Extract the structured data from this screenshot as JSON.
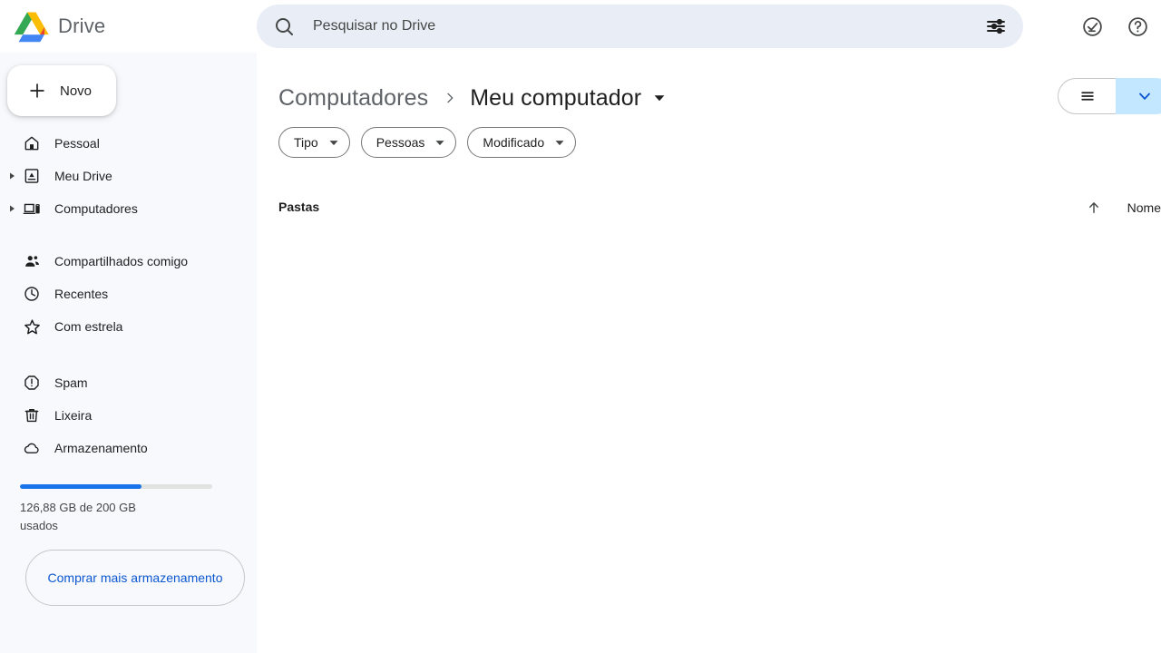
{
  "app": {
    "brand_name": "Drive",
    "logo_icon": "google-drive-logo"
  },
  "search": {
    "placeholder": "Pesquisar no Drive",
    "value": "",
    "search_icon": "search-icon",
    "tune_icon": "tune-filter-icon"
  },
  "topbar_actions": [
    {
      "name": "activity-status",
      "icon": "check-circle-icon"
    },
    {
      "name": "help",
      "icon": "help-circle-icon"
    }
  ],
  "sidebar": {
    "new_button": {
      "label": "Novo",
      "icon": "plus-icon"
    },
    "groups": [
      {
        "items": [
          {
            "label": "Pessoal",
            "icon": "home-icon",
            "expandable": false
          },
          {
            "label": "Meu Drive",
            "icon": "my-drive-icon",
            "expandable": true
          },
          {
            "label": "Computadores",
            "icon": "computer-icon",
            "expandable": true
          }
        ]
      },
      {
        "items": [
          {
            "label": "Compartilhados comigo",
            "icon": "people-icon",
            "expandable": false
          },
          {
            "label": "Recentes",
            "icon": "clock-icon",
            "expandable": false
          },
          {
            "label": "Com estrela",
            "icon": "star-icon",
            "expandable": false
          }
        ]
      },
      {
        "items": [
          {
            "label": "Spam",
            "icon": "report-icon",
            "expandable": false
          },
          {
            "label": "Lixeira",
            "icon": "trash-icon",
            "expandable": false
          },
          {
            "label": "Armazenamento",
            "icon": "cloud-icon",
            "expandable": false
          }
        ]
      }
    ],
    "storage": {
      "used_percent": 63,
      "text": "126,88 GB de 200 GB usados",
      "bar_color": "#1a73e8",
      "track_color": "#e1e3e1"
    },
    "buy_storage_button": {
      "label": "Comprar mais armazenamento",
      "color": "#0b57d0"
    }
  },
  "main": {
    "breadcrumb": {
      "root": "Computadores",
      "separator_icon": "chevron-right-icon",
      "current": "Meu computador",
      "caret_icon": "caret-down-icon"
    },
    "view_toggle": {
      "list_icon": "list-view-icon",
      "grid_icon": "grid-view-icon",
      "active": "grid"
    },
    "filter_chips": [
      {
        "label": "Tipo",
        "caret_icon": "caret-down-icon"
      },
      {
        "label": "Pessoas",
        "caret_icon": "caret-down-icon"
      },
      {
        "label": "Modificado",
        "caret_icon": "caret-down-icon"
      }
    ],
    "section": {
      "title": "Pastas",
      "sort_arrow_icon": "arrow-up-icon",
      "sort_column_label": "Nome"
    }
  }
}
